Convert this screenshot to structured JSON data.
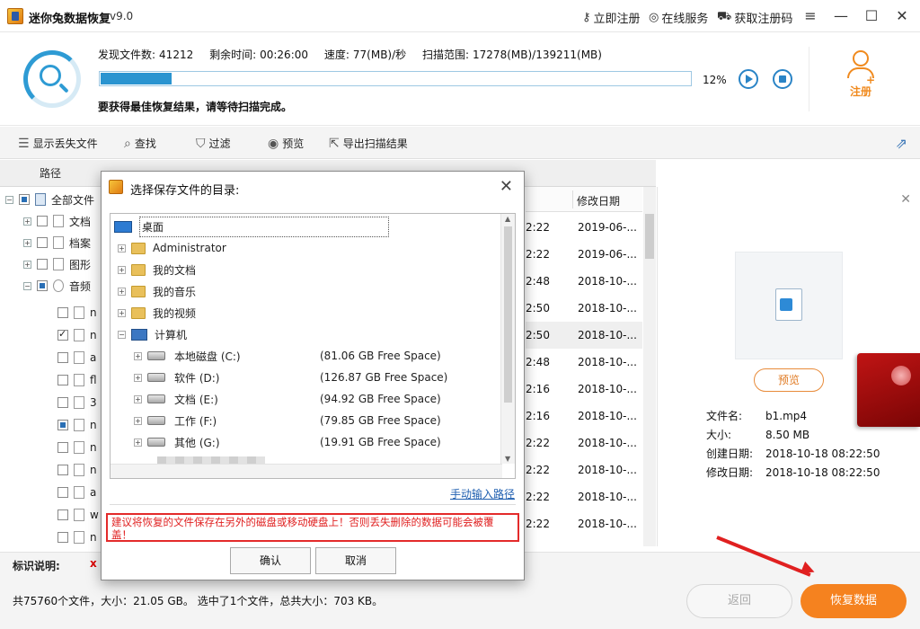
{
  "titlebar": {
    "app_name": "迷你兔数据恢复",
    "version": "v9.0",
    "links": [
      "立即注册",
      "在线服务",
      "获取注册码"
    ],
    "window_controls": [
      "menu-icon",
      "minimize-icon",
      "maximize-icon",
      "close-icon"
    ]
  },
  "scan": {
    "found_label": "发现文件数:",
    "found_value": "41212",
    "remain_label": "剩余时间:",
    "remain_value": "00:26:00",
    "speed_label": "速度:",
    "speed_value": "77(MB)/秒",
    "range_label": "扫描范围:",
    "range_value": "17278(MB)/139211(MB)",
    "progress_percent": 12,
    "progress_text": "12%",
    "hint": "要获得最佳恢复结果，请等待扫描完成。",
    "register_label": "注册"
  },
  "toolbar": {
    "items": [
      {
        "label": "显示丢失文件",
        "icon": "list-icon"
      },
      {
        "label": "查找",
        "icon": "search-icon"
      },
      {
        "label": "过滤",
        "icon": "filter-icon"
      },
      {
        "label": "预览",
        "icon": "eye-icon"
      },
      {
        "label": "导出扫描结果",
        "icon": "export-icon"
      }
    ]
  },
  "tabs": {
    "path": "路径"
  },
  "tree": {
    "root": "全部文件",
    "items": [
      "文档",
      "档案",
      "图形",
      "音频"
    ],
    "file_prefixes": [
      "n",
      "n",
      "a",
      "fl",
      "3",
      "n",
      "n",
      "n",
      "a",
      "w",
      "n"
    ]
  },
  "list": {
    "col_date": "修改日期",
    "rows": [
      {
        "time": "2:22",
        "date": "2019-06-..."
      },
      {
        "time": "2:22",
        "date": "2019-06-..."
      },
      {
        "time": "2:48",
        "date": "2018-10-..."
      },
      {
        "time": "2:50",
        "date": "2018-10-..."
      },
      {
        "time": "2:50",
        "date": "2018-10-..."
      },
      {
        "time": "2:48",
        "date": "2018-10-..."
      },
      {
        "time": "2:16",
        "date": "2018-10-..."
      },
      {
        "time": "2:16",
        "date": "2018-10-..."
      },
      {
        "time": "2:22",
        "date": "2018-10-..."
      },
      {
        "time": "2:22",
        "date": "2018-10-..."
      },
      {
        "time": "2:22",
        "date": "2018-10-..."
      },
      {
        "time": "2:22",
        "date": "2018-10-..."
      },
      {
        "time": "2:22",
        "date": "2018-10"
      }
    ]
  },
  "preview": {
    "button": "预览",
    "info": [
      {
        "k": "文件名:",
        "v": "b1.mp4"
      },
      {
        "k": "大小:",
        "v": "8.50 MB"
      },
      {
        "k": "创建日期:",
        "v": "2018-10-18 08:22:50"
      },
      {
        "k": "修改日期:",
        "v": "2018-10-18 08:22:50"
      }
    ]
  },
  "legend": {
    "label": "标识说明:",
    "mark": "x"
  },
  "status": {
    "text": "共75760个文件，大小：21.05 GB。 选中了1个文件，总共大小：703 KB。",
    "back": "返回",
    "recover": "恢复数据"
  },
  "dialog": {
    "title": "选择保存文件的目录:",
    "desktop": "桌面",
    "folders": [
      "Administrator",
      "我的文档",
      "我的音乐",
      "我的视频"
    ],
    "computer": "计算机",
    "drives": [
      {
        "name": "本地磁盘 (C:)",
        "free": "(81.06 GB Free Space)"
      },
      {
        "name": "软件 (D:)",
        "free": "(126.87 GB Free Space)"
      },
      {
        "name": "文档 (E:)",
        "free": "(94.92 GB Free Space)"
      },
      {
        "name": "工作 (F:)",
        "free": "(79.85 GB Free Space)"
      },
      {
        "name": "其他 (G:)",
        "free": "(19.91 GB Free Space)"
      }
    ],
    "manual_path": "手动输入路径",
    "warning": "建议将恢复的文件保存在另外的磁盘或移动硬盘上！否则丢失删除的数据可能会被覆盖！",
    "ok": "确认",
    "cancel": "取消"
  },
  "colors": {
    "accent_blue": "#2a94d0",
    "accent_orange": "#f5821f",
    "warning_red": "#e02020"
  }
}
